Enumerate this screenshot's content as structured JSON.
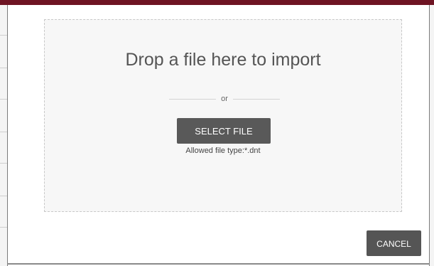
{
  "dialog": {
    "drop_title": "Drop a file here to import",
    "separator_text": "or",
    "select_button_label": "SELECT FILE",
    "allowed_types_text": "Allowed file type:*.dnt",
    "cancel_button_label": "CANCEL"
  },
  "colors": {
    "top_bar": "#6e1423",
    "button_bg": "#595959",
    "drop_zone_bg": "#f7f7f7"
  }
}
